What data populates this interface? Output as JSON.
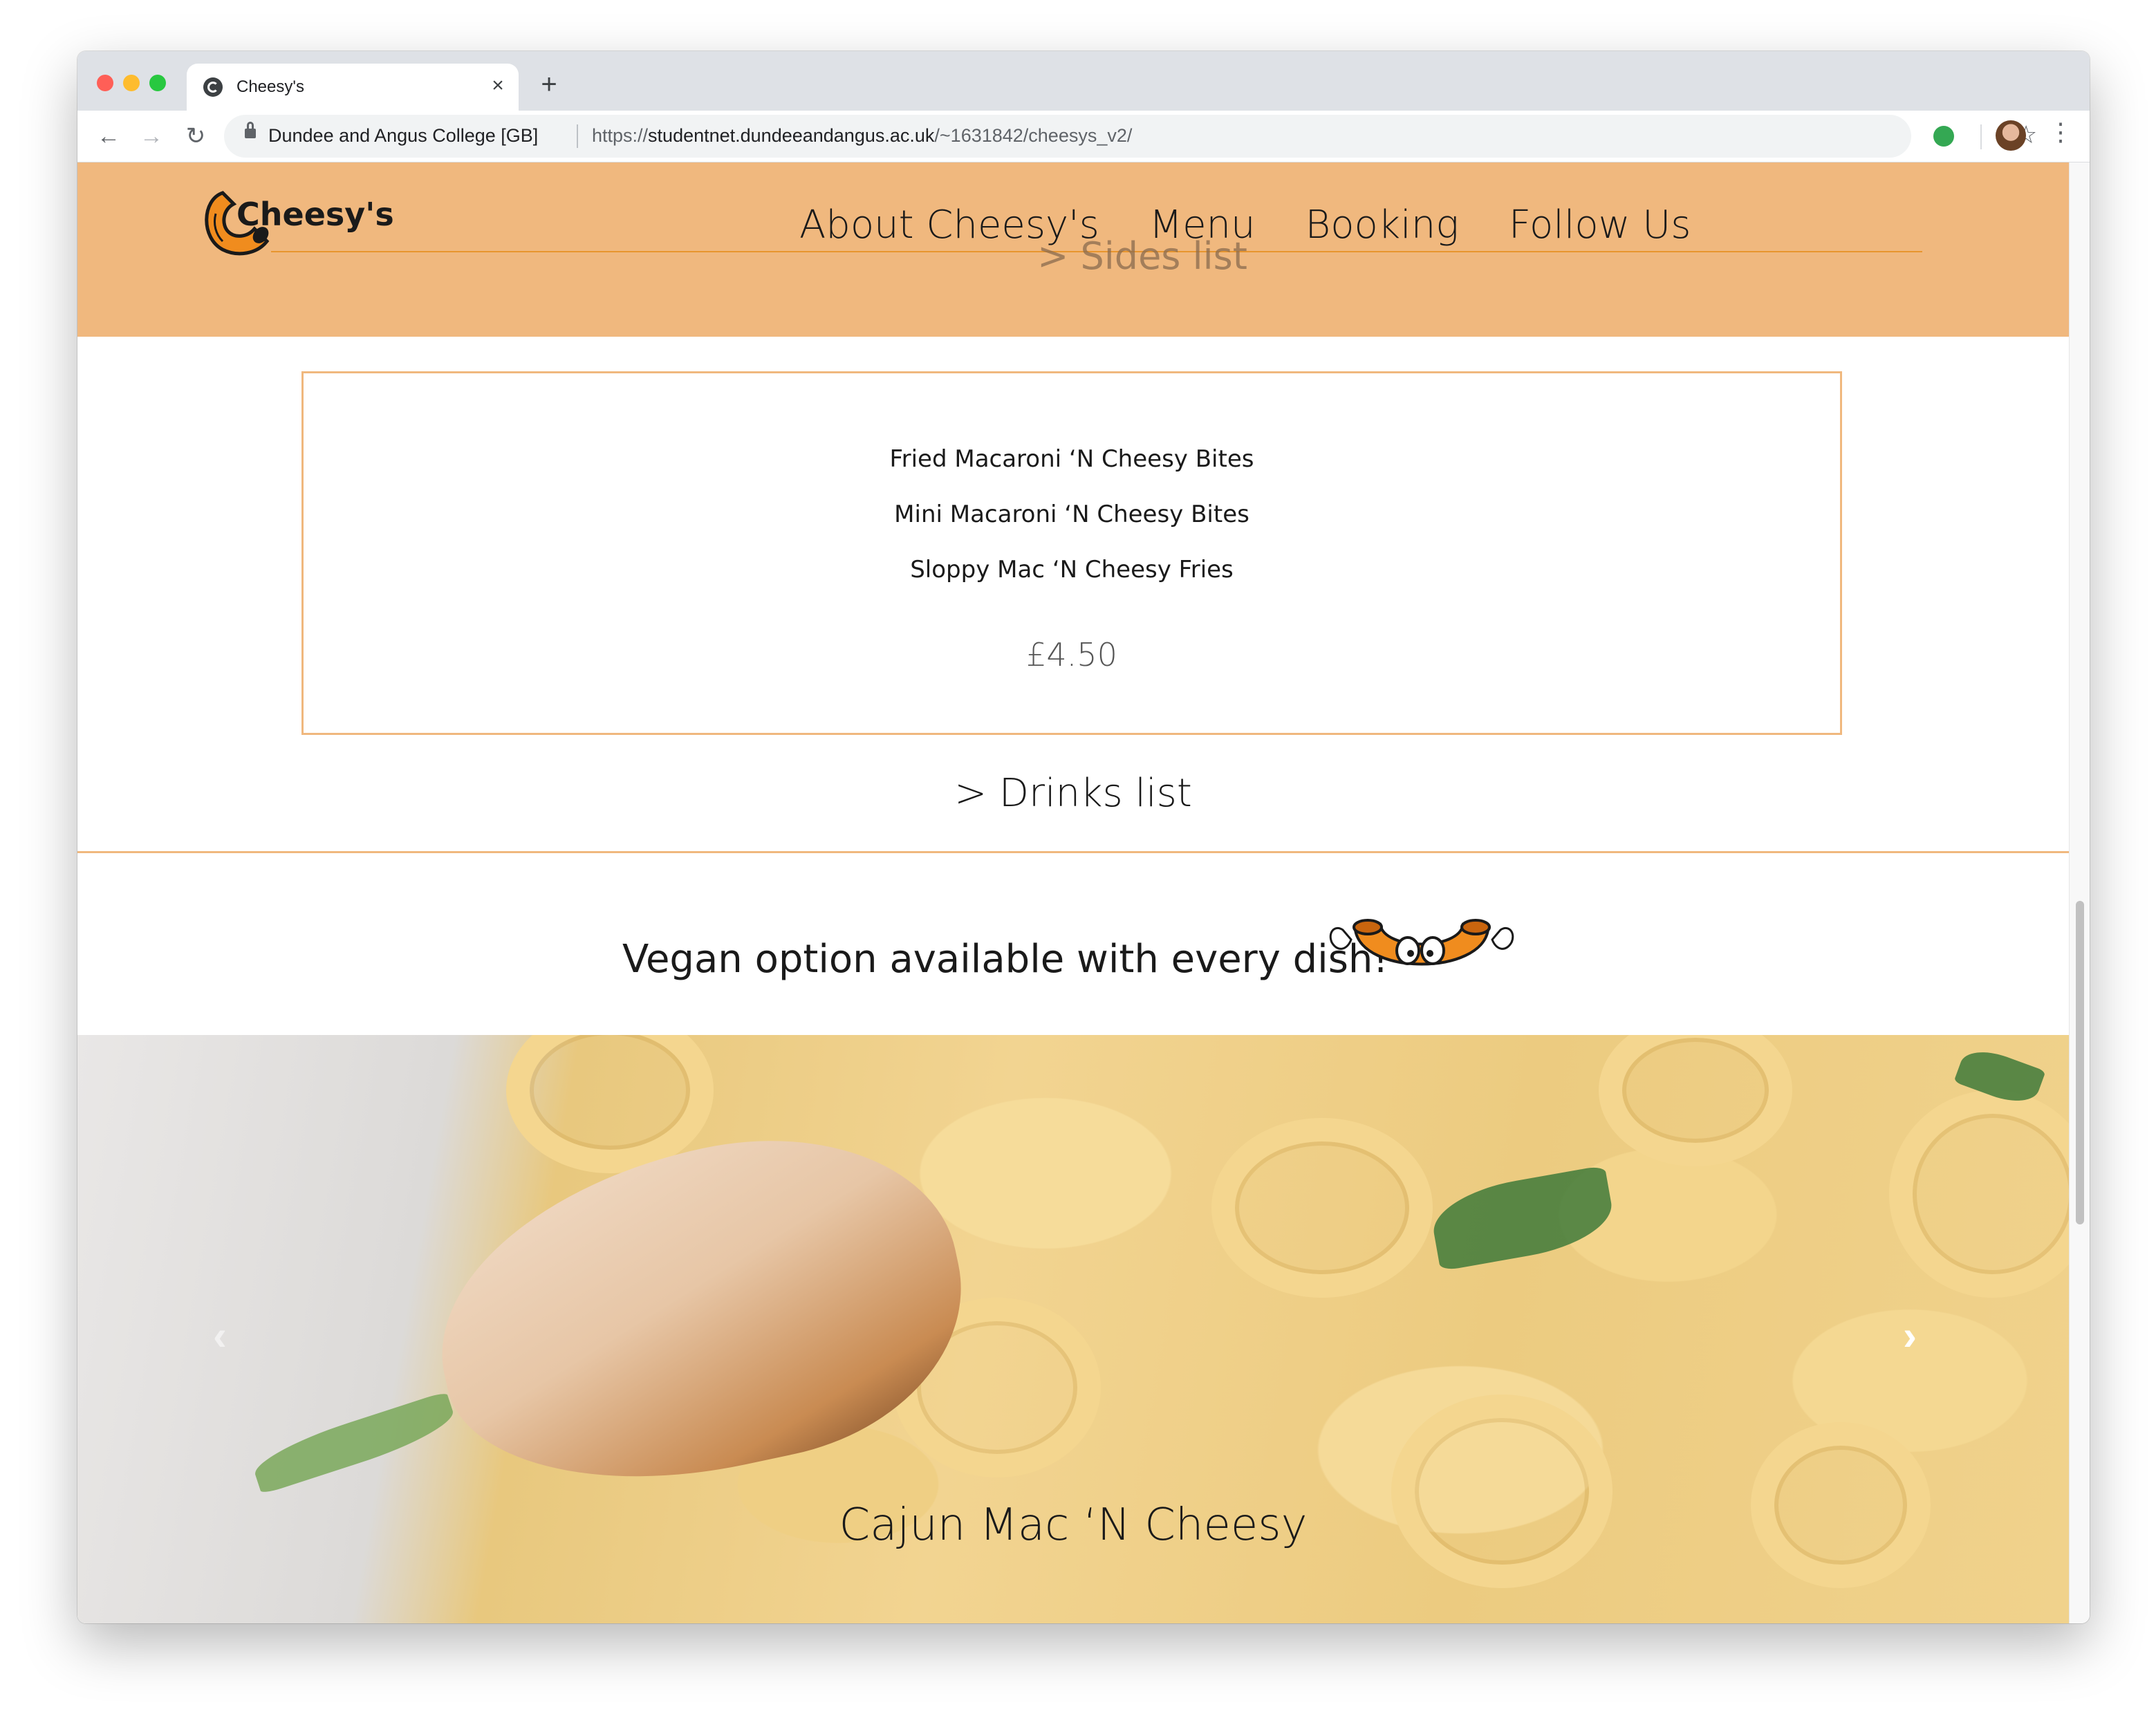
{
  "browser": {
    "tab_title": "Cheesy's",
    "tab_close": "×",
    "new_tab": "+",
    "site_identity": "Dundee and Angus College [GB]",
    "url_scheme": "https://",
    "url_host": "studentnet.dundeeandangus.ac.uk",
    "url_path": "/~1631842/cheesys_v2/",
    "back_icon": "←",
    "forward_icon": "→",
    "reload_icon": "↻",
    "star_icon": "☆",
    "menu_icon": "⋮"
  },
  "site": {
    "logo_text": "Cheesy's",
    "nav": [
      "About Cheesy's",
      "Menu",
      "Booking",
      "Follow Us"
    ],
    "sub_nav": "> Sides list"
  },
  "sides": {
    "items": [
      "Fried Macaroni ‘N Cheesy Bites",
      "Mini Macaroni ‘N Cheesy Bites",
      "Sloppy Mac ‘N Cheesy Fries"
    ],
    "price": "£4.50"
  },
  "drinks_link": "> Drinks list",
  "vegan_banner": "Vegan option available with every dish!",
  "carousel": {
    "caption": "Cajun Mac ‘N Cheesy",
    "prev_icon": "‹",
    "next_icon": "›"
  },
  "colors": {
    "header_bg": "#f0b87e",
    "accent_line": "#e8952e",
    "logo_orange": "#f08c1e"
  }
}
